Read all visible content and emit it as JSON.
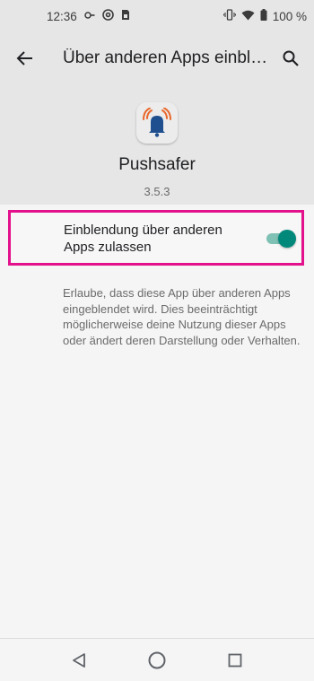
{
  "status_bar": {
    "time": "12:36",
    "battery": "100 %",
    "left_icons": [
      "vpn-key-icon",
      "at-sign-icon",
      "sim-card-icon"
    ],
    "right_icons": [
      "vibrate-icon",
      "wifi-icon",
      "battery-icon"
    ]
  },
  "toolbar": {
    "title": "Über anderen Apps einblenden",
    "back_icon": "arrow-back-icon",
    "search_icon": "search-icon"
  },
  "app": {
    "name": "Pushsafer",
    "version": "3.5.3",
    "icon": "pushsafer-bell-icon"
  },
  "setting": {
    "label": "Einblendung über anderen Apps zulassen",
    "enabled": true,
    "highlight_color": "#e3118c"
  },
  "description": "Erlaube, dass diese App über anderen Apps eingeblendet wird. Dies beeinträchtigt möglicherweise deine Nutzung dieser Apps oder ändert deren Darstellung oder Verhalten.",
  "nav": {
    "buttons": [
      "back-triangle-icon",
      "home-circle-icon",
      "recents-square-icon"
    ]
  },
  "colors": {
    "accent": "#00897b",
    "header_bg": "#e6e6e6",
    "body_bg": "#f5f5f5"
  }
}
